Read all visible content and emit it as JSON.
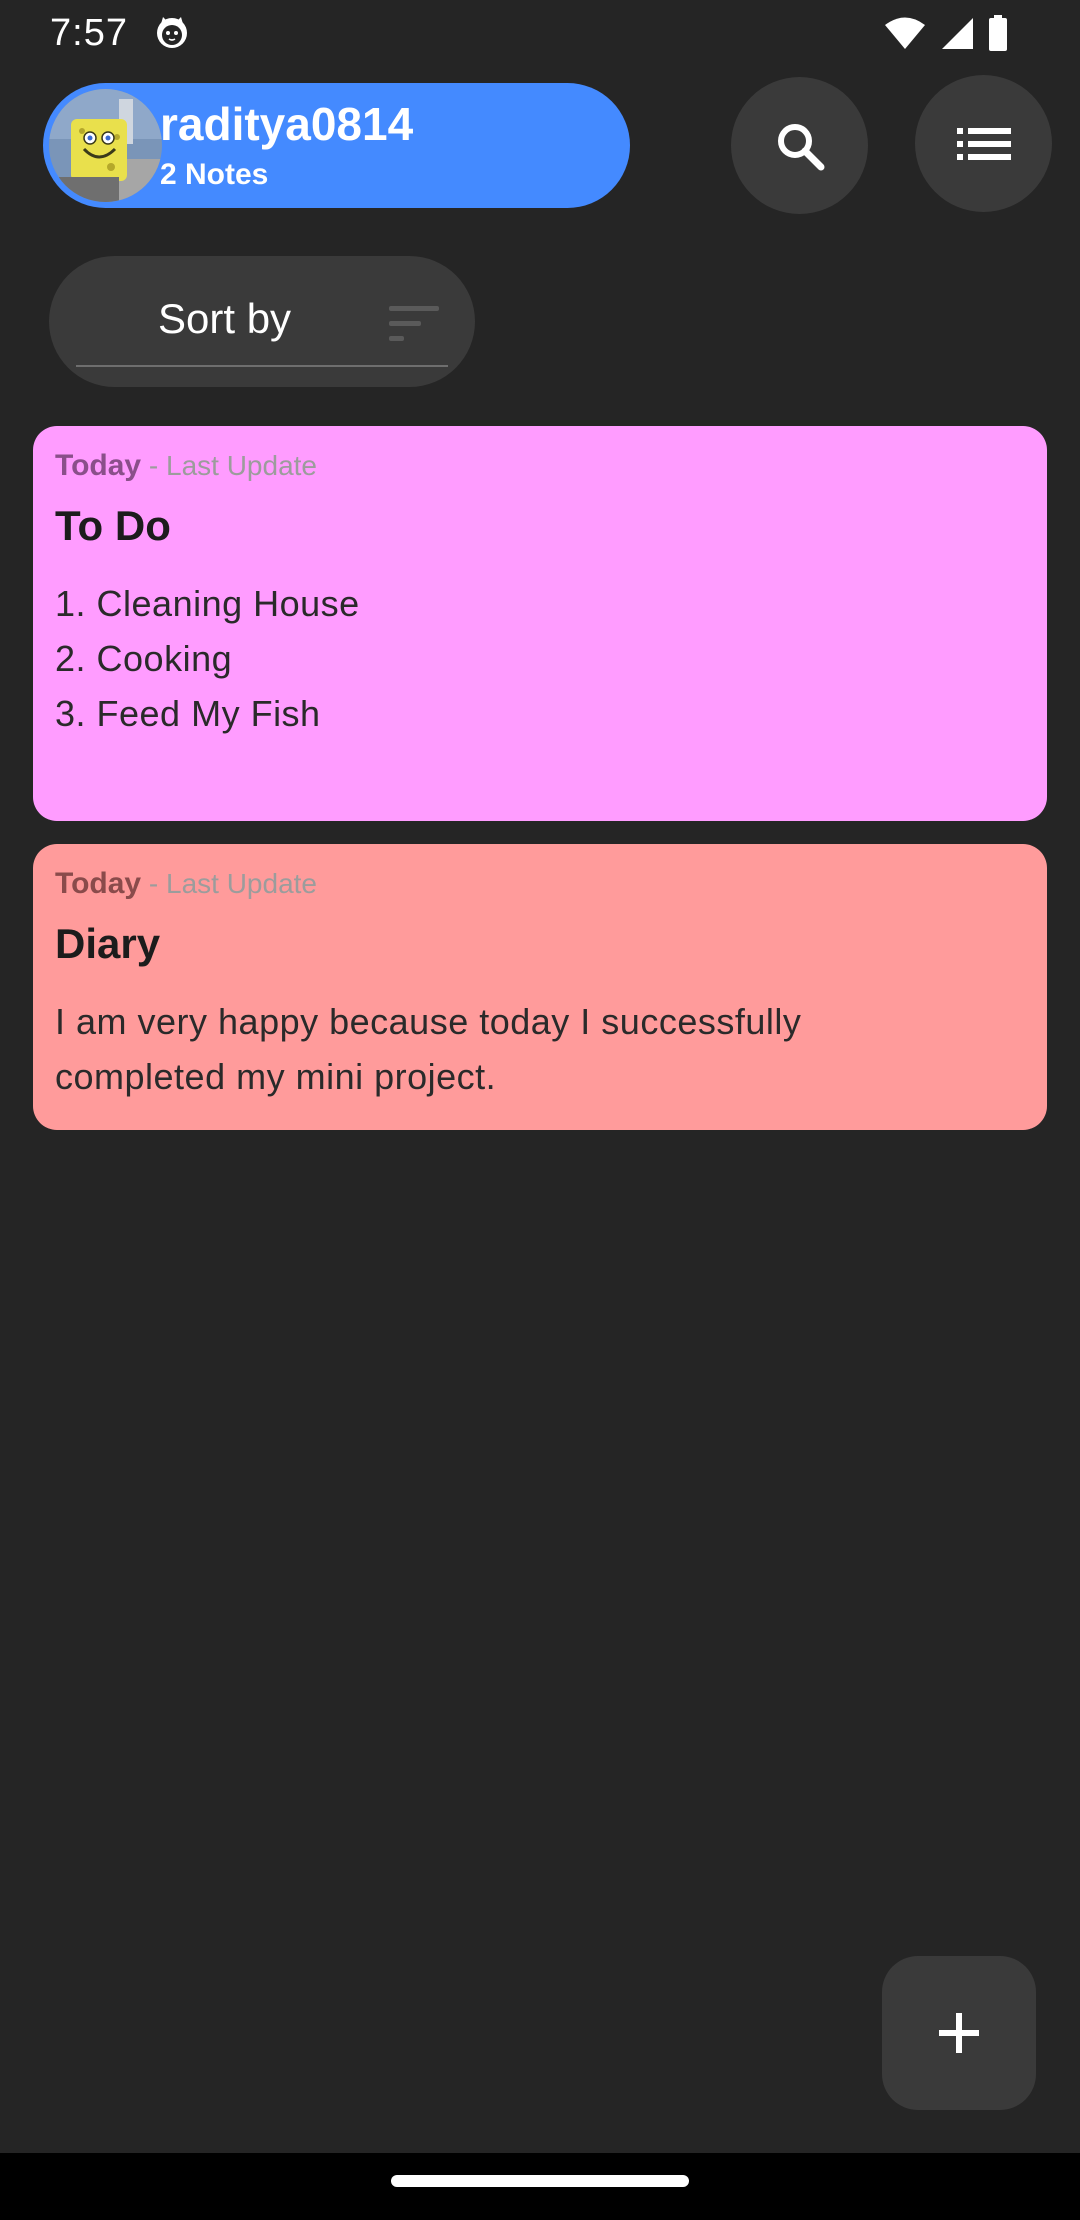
{
  "status_bar": {
    "time": "7:57"
  },
  "header": {
    "username": "raditya0814",
    "notes_count": "2 Notes"
  },
  "sort": {
    "label": "Sort by"
  },
  "notes": [
    {
      "date": "Today",
      "update_label": " - Last Update",
      "title": "To Do",
      "lines": [
        "1. Cleaning House",
        "2. Cooking",
        "3. Feed My Fish"
      ],
      "color": "#ff9cff"
    },
    {
      "date": "Today",
      "update_label": " - Last Update",
      "title": "Diary",
      "lines": [
        "I am very happy because today I successfully",
        "completed my mini project."
      ],
      "color": "#ff9b9b"
    }
  ],
  "colors": {
    "background": "#252525",
    "accent": "#448aff",
    "button": "#3a3a3a"
  },
  "icons": {
    "search": "search-icon",
    "view": "list-view-icon",
    "sort": "sort-icon",
    "add": "plus-icon"
  }
}
